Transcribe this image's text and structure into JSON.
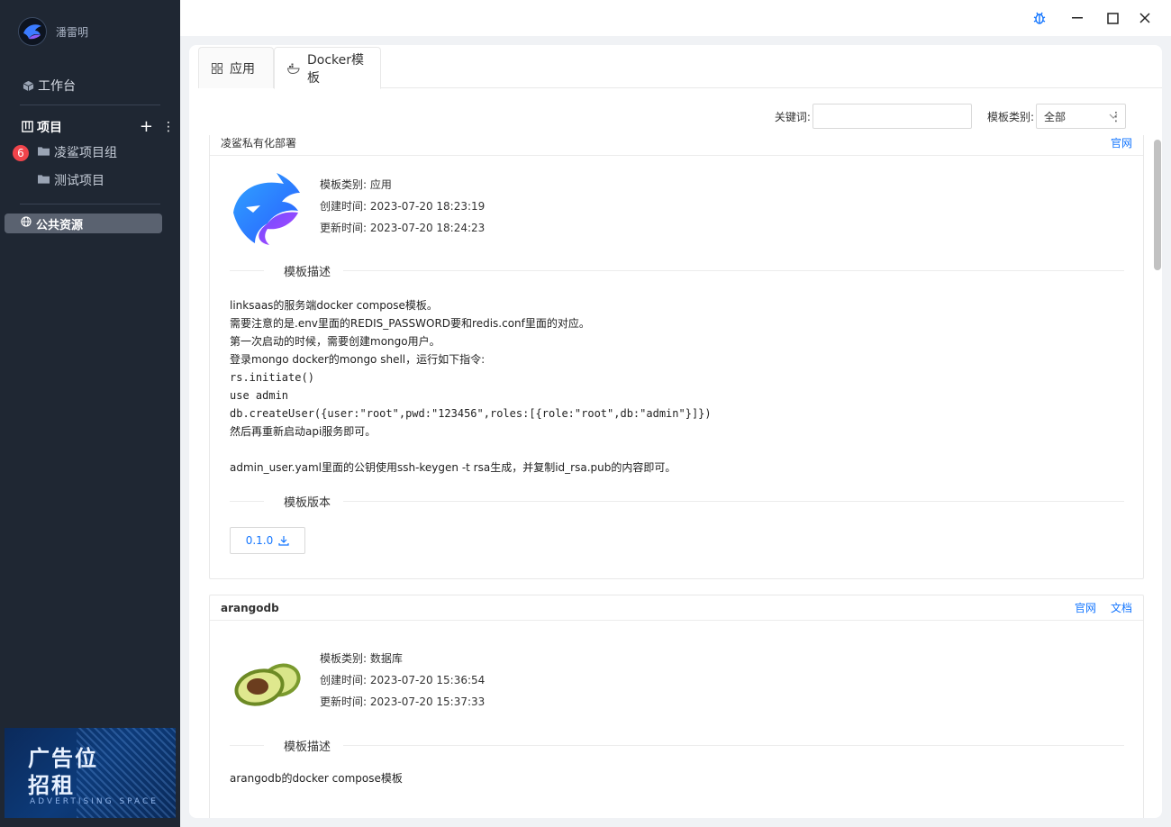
{
  "sidebar": {
    "user_name": "潘雷明",
    "workbench": "工作台",
    "projects_label": "项目",
    "badge_count": "6",
    "project_items": [
      "凌鲨项目组",
      "测试项目"
    ],
    "public_resources": "公共资源",
    "ad": {
      "line1": "广告位",
      "line2": "招租",
      "line3": "ADVERTISING SPACE"
    }
  },
  "tabs": [
    {
      "label": "应用",
      "icon": "grid-icon",
      "active": false
    },
    {
      "label": "Docker模板",
      "icon": "docker-icon",
      "active": true
    }
  ],
  "filters": {
    "keyword_label": "关键词:",
    "keyword_value": "",
    "category_label": "模板类别:",
    "category_value": "全部"
  },
  "cards": [
    {
      "title": "凌鲨私有化部署",
      "links": [
        "官网"
      ],
      "category": "模板类别: 应用",
      "created": "创建时间: 2023-07-20 18:23:19",
      "updated": "更新时间: 2023-07-20 18:24:23",
      "desc_title": "模板描述",
      "desc_lines": [
        "linksaas的服务端docker compose模板。",
        "需要注意的是.env里面的REDIS_PASSWORD要和redis.conf里面的对应。",
        "第一次启动的时候，需要创建mongo用户。",
        "登录mongo docker的mongo shell，运行如下指令:",
        "rs.initiate()",
        "use admin",
        "db.createUser({user:\"root\",pwd:\"123456\",roles:[{role:\"root\",db:\"admin\"}]})",
        "然后再重新启动api服务即可。",
        "",
        "admin_user.yaml里面的公钥使用ssh-keygen -t rsa生成，并复制id_rsa.pub的内容即可。"
      ],
      "version_title": "模板版本",
      "version": "0.1.0"
    },
    {
      "title": "arangodb",
      "links": [
        "官网",
        "文档"
      ],
      "category": "模板类别: 数据库",
      "created": "创建时间: 2023-07-20 15:36:54",
      "updated": "更新时间: 2023-07-20 15:37:33",
      "desc_title": "模板描述",
      "desc_lines": [
        "arangodb的docker compose模板"
      ]
    }
  ],
  "colors": {
    "sidebar_bg": "#1f2733",
    "accent": "#1677ff",
    "badge": "#f0444b"
  }
}
